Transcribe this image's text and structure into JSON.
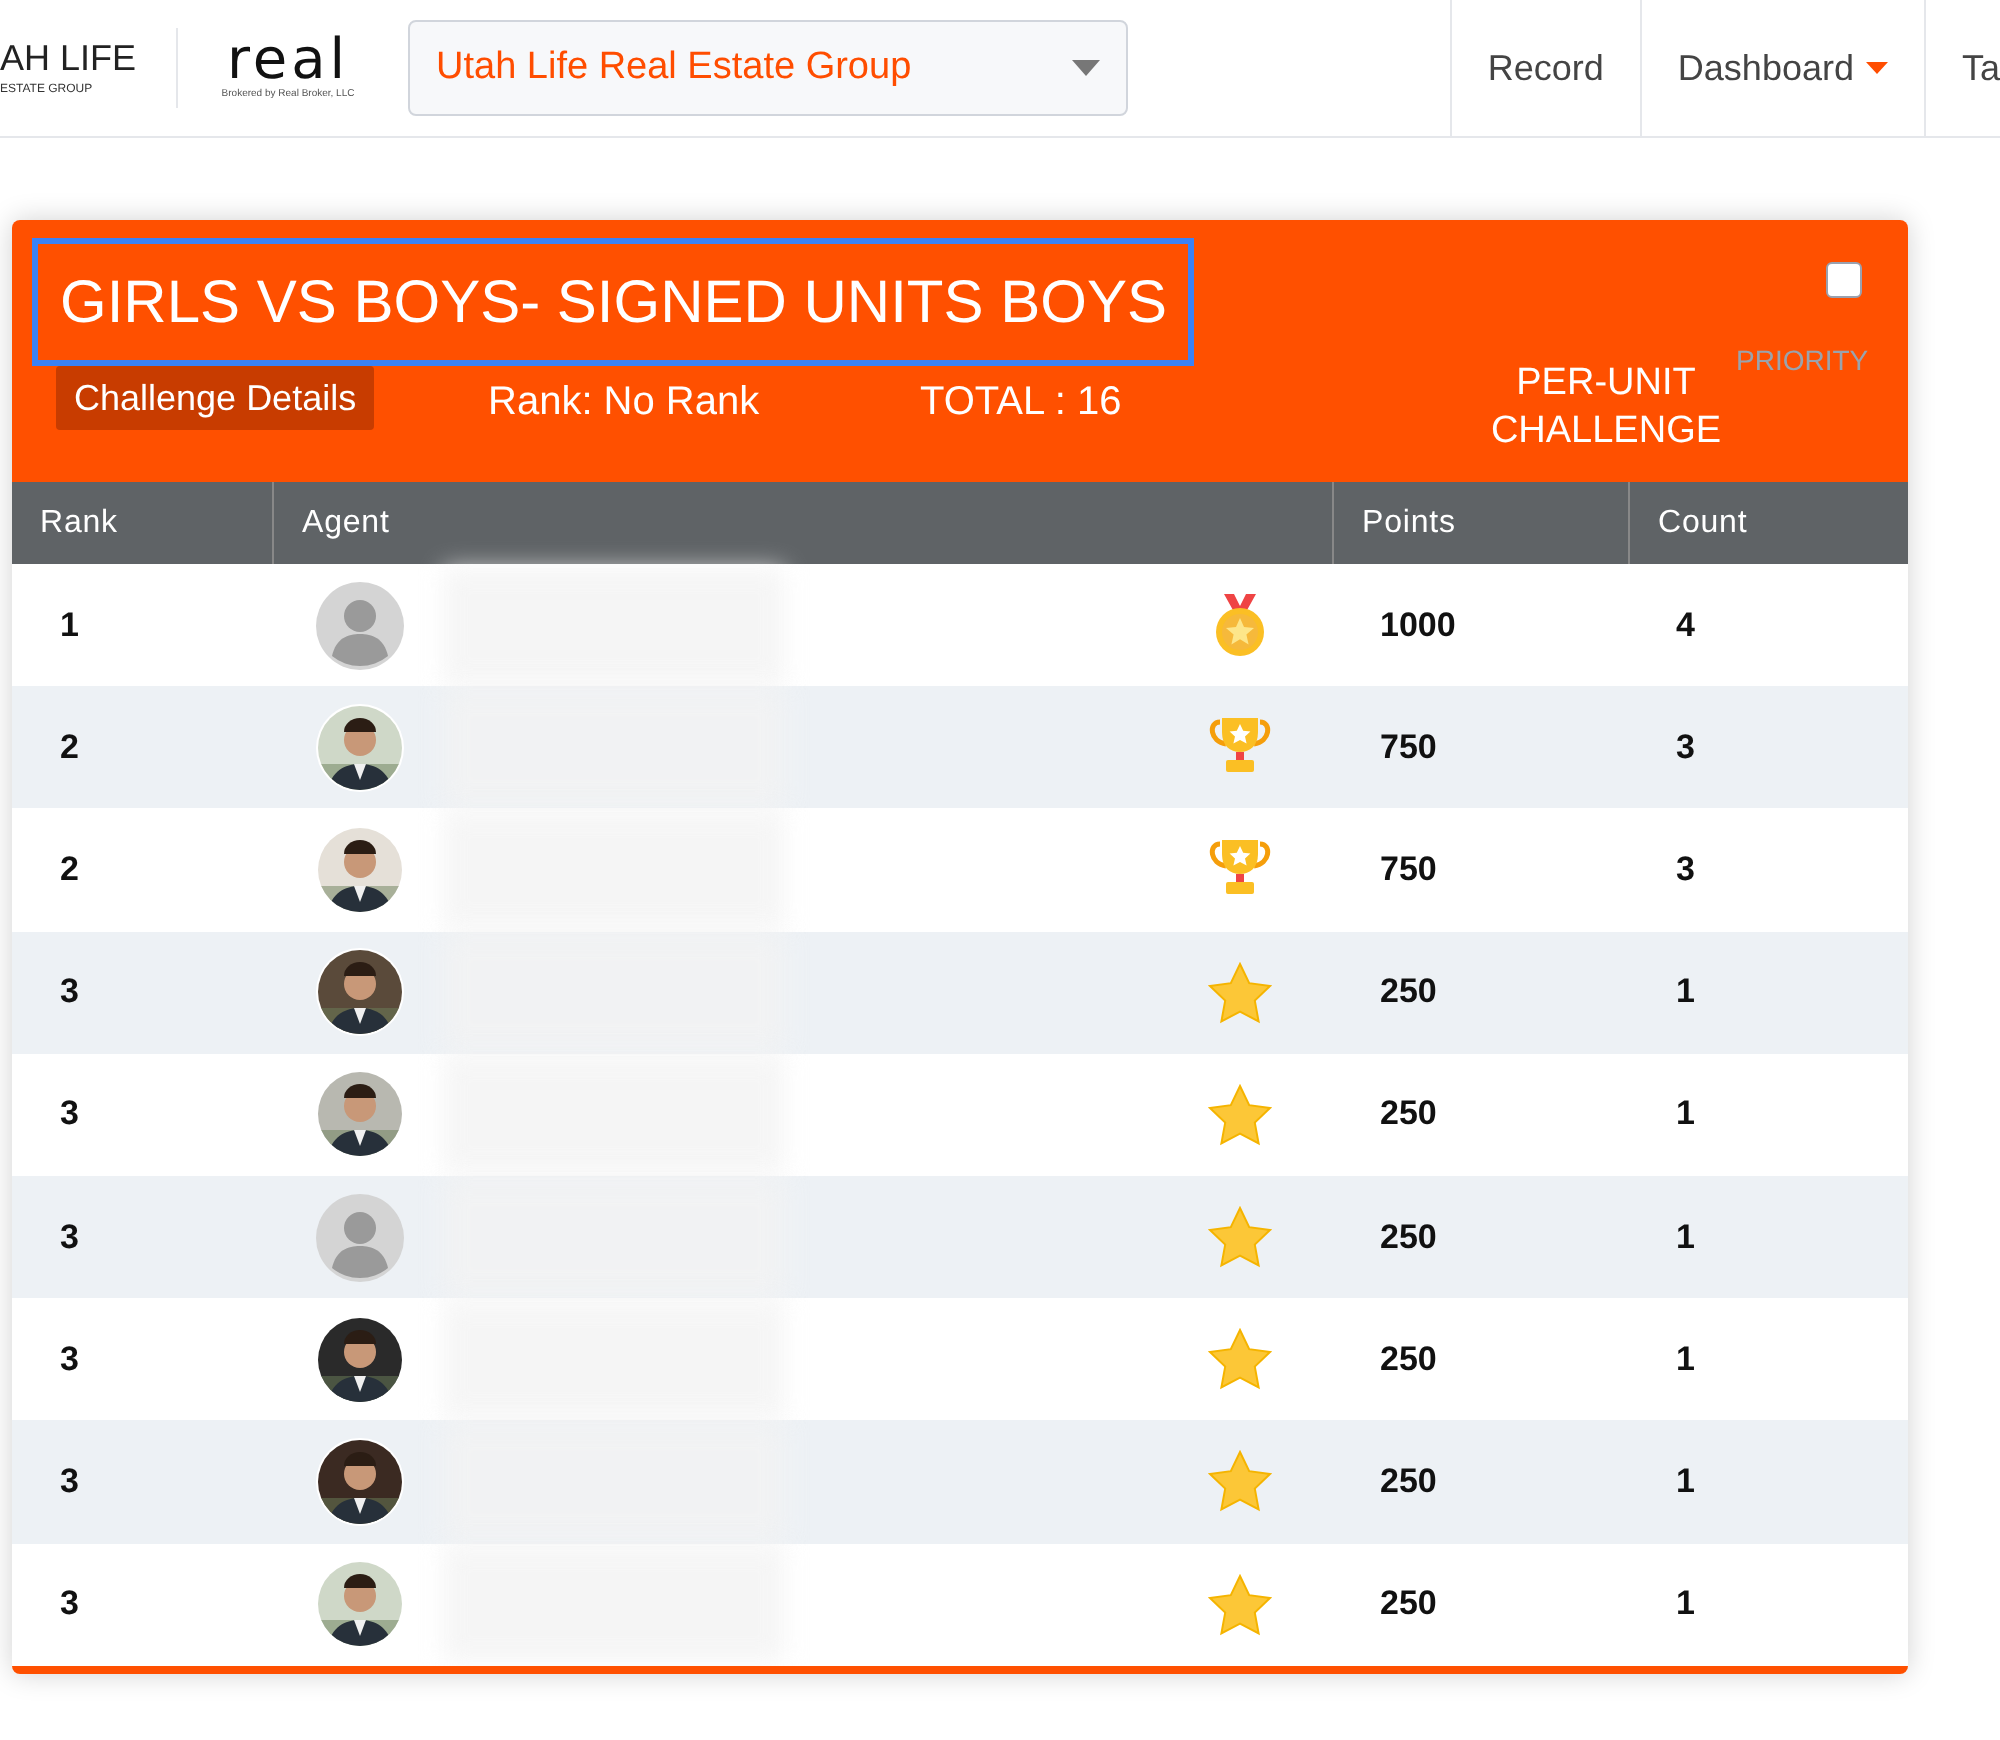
{
  "header": {
    "logo_text": "AH LIFE",
    "logo_subtext": "ESTATE GROUP",
    "brand_logo": "real",
    "brand_subtext": "Brokered by Real Broker, LLC",
    "team_select": {
      "value": "Utah Life Real Estate Group"
    },
    "nav": [
      {
        "label": "Record",
        "dropdown": false
      },
      {
        "label": "Dashboard",
        "dropdown": true
      },
      {
        "label": "Ta",
        "dropdown": false
      }
    ]
  },
  "challenge": {
    "title": "GIRLS VS BOYS- SIGNED UNITS BOYS",
    "title_focused": true,
    "details_button": "Challenge Details",
    "rank": "Rank: No Rank",
    "total": "TOTAL : 16",
    "priority": {
      "label": "PRIORITY",
      "checked": false
    },
    "type": "PER-UNIT CHALLENGE"
  },
  "table": {
    "columns": [
      "Rank",
      "Agent",
      "Points",
      "Count"
    ],
    "rows": [
      {
        "rank": "1",
        "avatar": {
          "kind": "placeholder"
        },
        "award": {
          "kind": "medal"
        },
        "points": "1000",
        "count": "4"
      },
      {
        "rank": "2",
        "award": {
          "kind": "trophy"
        },
        "points": "750",
        "count": "3"
      },
      {
        "rank": "2",
        "award": {
          "kind": "trophy"
        },
        "points": "750",
        "count": "3"
      },
      {
        "rank": "3",
        "award": {
          "kind": "star"
        },
        "points": "250",
        "count": "1"
      },
      {
        "rank": "3",
        "award": {
          "kind": "star"
        },
        "points": "250",
        "count": "1"
      },
      {
        "rank": "3",
        "avatar": {
          "kind": "placeholder"
        },
        "award": {
          "kind": "star"
        },
        "points": "250",
        "count": "1"
      },
      {
        "rank": "3",
        "award": {
          "kind": "star"
        },
        "points": "250",
        "count": "1"
      },
      {
        "rank": "3",
        "award": {
          "kind": "star"
        },
        "points": "250",
        "count": "1"
      },
      {
        "rank": "3",
        "award": {
          "kind": "star"
        },
        "points": "250",
        "count": "1"
      }
    ]
  }
}
